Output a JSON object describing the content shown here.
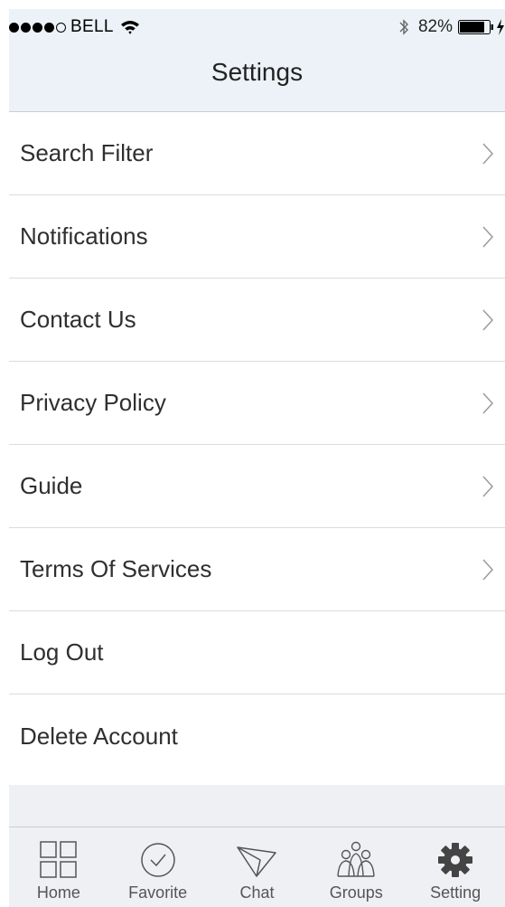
{
  "status_bar": {
    "carrier": "BELL",
    "battery_percent": "82%",
    "signal_bars_filled": 4,
    "signal_bars_total": 5
  },
  "nav": {
    "title": "Settings"
  },
  "menu": {
    "items": [
      {
        "label": "Search Filter",
        "chevron": true
      },
      {
        "label": "Notifications",
        "chevron": true
      },
      {
        "label": "Contact Us",
        "chevron": true
      },
      {
        "label": "Privacy Policy",
        "chevron": true
      },
      {
        "label": "Guide",
        "chevron": true
      },
      {
        "label": "Terms Of Services",
        "chevron": true
      },
      {
        "label": "Log Out",
        "chevron": false
      },
      {
        "label": "Delete Account",
        "chevron": false
      }
    ]
  },
  "tabbar": {
    "tabs": [
      {
        "label": "Home",
        "icon": "grid-icon"
      },
      {
        "label": "Favorite",
        "icon": "check-circle-icon"
      },
      {
        "label": "Chat",
        "icon": "paper-plane-icon"
      },
      {
        "label": "Groups",
        "icon": "people-group-icon"
      },
      {
        "label": "Setting",
        "icon": "gear-icon",
        "active": true
      }
    ]
  },
  "colors": {
    "header_bg": "#edf2f8",
    "tabbar_bg": "#eef0f3",
    "text": "#2f2f2f",
    "chevron": "#9b9b9b",
    "divider": "#dcdcdc"
  }
}
